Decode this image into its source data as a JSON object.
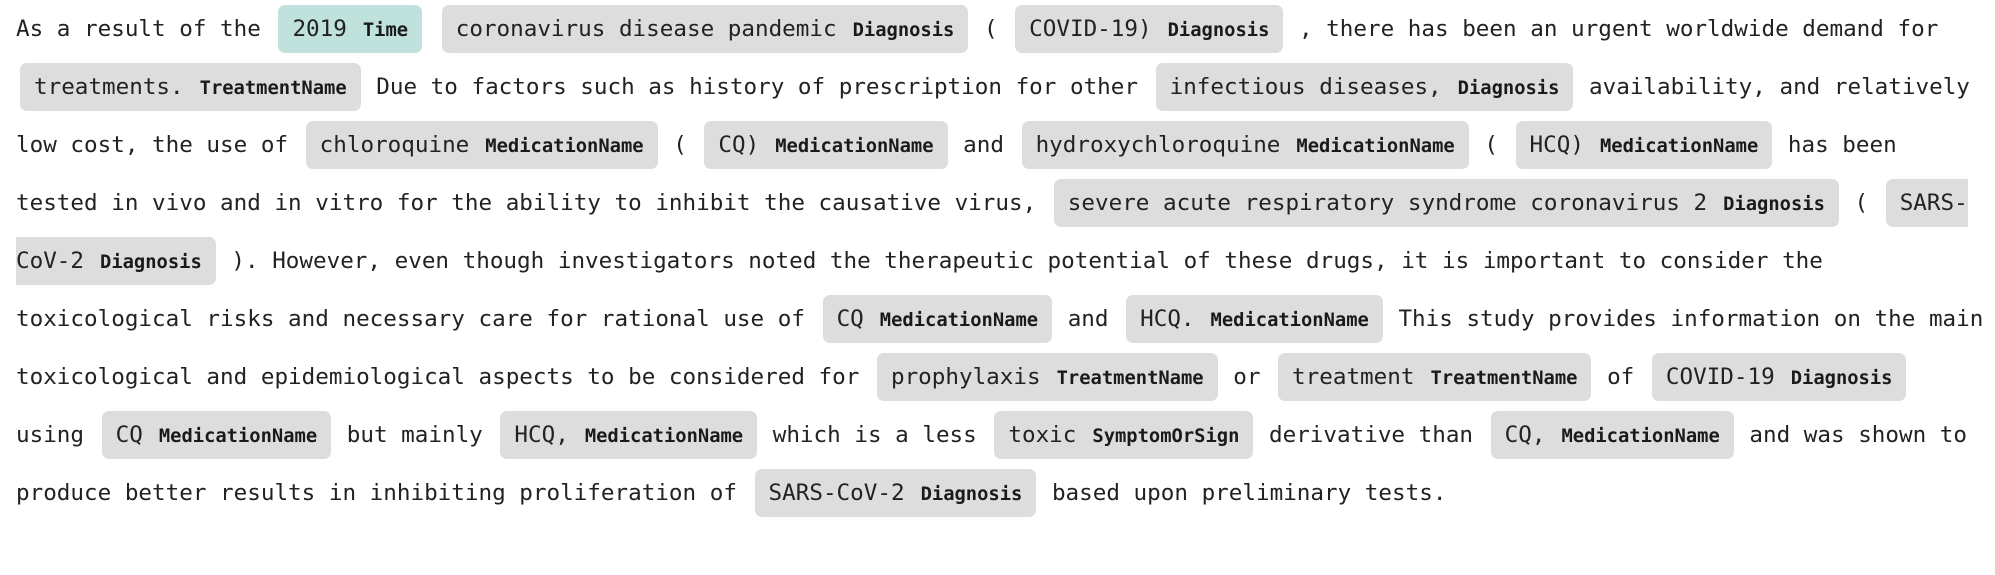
{
  "document": {
    "colors": {
      "entity_default": "#dddddd",
      "entity_time": "#c0e2dc",
      "text": "#222222"
    },
    "segments": [
      {
        "type": "text",
        "text": "As a result of the "
      },
      {
        "type": "entity",
        "text": "2019",
        "label": "Time"
      },
      {
        "type": "text",
        "text": " "
      },
      {
        "type": "entity",
        "text": "coronavirus disease pandemic",
        "label": "Diagnosis"
      },
      {
        "type": "text",
        "text": " ( "
      },
      {
        "type": "entity",
        "text": "COVID-19)",
        "label": "Diagnosis"
      },
      {
        "type": "text",
        "text": " , there has been an urgent worldwide demand for "
      },
      {
        "type": "entity",
        "text": "treatments.",
        "label": "TreatmentName"
      },
      {
        "type": "text",
        "text": " Due to factors such as history of prescription for other "
      },
      {
        "type": "entity",
        "text": "infectious diseases,",
        "label": "Diagnosis"
      },
      {
        "type": "text",
        "text": " availability, and relatively low cost, the use of "
      },
      {
        "type": "entity",
        "text": "chloroquine",
        "label": "MedicationName"
      },
      {
        "type": "text",
        "text": " ( "
      },
      {
        "type": "entity",
        "text": "CQ)",
        "label": "MedicationName"
      },
      {
        "type": "text",
        "text": " and "
      },
      {
        "type": "entity",
        "text": "hydroxychloroquine",
        "label": "MedicationName"
      },
      {
        "type": "text",
        "text": " ( "
      },
      {
        "type": "entity",
        "text": "HCQ)",
        "label": "MedicationName"
      },
      {
        "type": "text",
        "text": " has been tested in vivo and in vitro for the ability to inhibit the causative virus, "
      },
      {
        "type": "entity",
        "text": "severe acute respiratory syndrome coronavirus 2",
        "label": "Diagnosis"
      },
      {
        "type": "text",
        "text": " ( "
      },
      {
        "type": "entity",
        "text": "SARS-CoV-2",
        "label": "Diagnosis"
      },
      {
        "type": "text",
        "text": " ). However, even though investigators noted the therapeutic potential of these drugs, it is important to consider the toxicological risks and necessary care for rational use of "
      },
      {
        "type": "entity",
        "text": "CQ",
        "label": "MedicationName"
      },
      {
        "type": "text",
        "text": " and "
      },
      {
        "type": "entity",
        "text": "HCQ.",
        "label": "MedicationName"
      },
      {
        "type": "text",
        "text": " This study provides information on the main toxicological and epidemiological aspects to be considered for "
      },
      {
        "type": "entity",
        "text": "prophylaxis",
        "label": "TreatmentName"
      },
      {
        "type": "text",
        "text": " or "
      },
      {
        "type": "entity",
        "text": "treatment",
        "label": "TreatmentName"
      },
      {
        "type": "text",
        "text": " of "
      },
      {
        "type": "entity",
        "text": "COVID-19",
        "label": "Diagnosis"
      },
      {
        "type": "text",
        "text": " using "
      },
      {
        "type": "entity",
        "text": "CQ",
        "label": "MedicationName"
      },
      {
        "type": "text",
        "text": " but mainly "
      },
      {
        "type": "entity",
        "text": "HCQ,",
        "label": "MedicationName"
      },
      {
        "type": "text",
        "text": " which is a less "
      },
      {
        "type": "entity",
        "text": "toxic",
        "label": "SymptomOrSign"
      },
      {
        "type": "text",
        "text": " derivative than "
      },
      {
        "type": "entity",
        "text": "CQ,",
        "label": "MedicationName"
      },
      {
        "type": "text",
        "text": " and was shown to produce better results in inhibiting proliferation of "
      },
      {
        "type": "entity",
        "text": "SARS-CoV-2",
        "label": "Diagnosis"
      },
      {
        "type": "text",
        "text": " based upon preliminary tests."
      }
    ]
  }
}
